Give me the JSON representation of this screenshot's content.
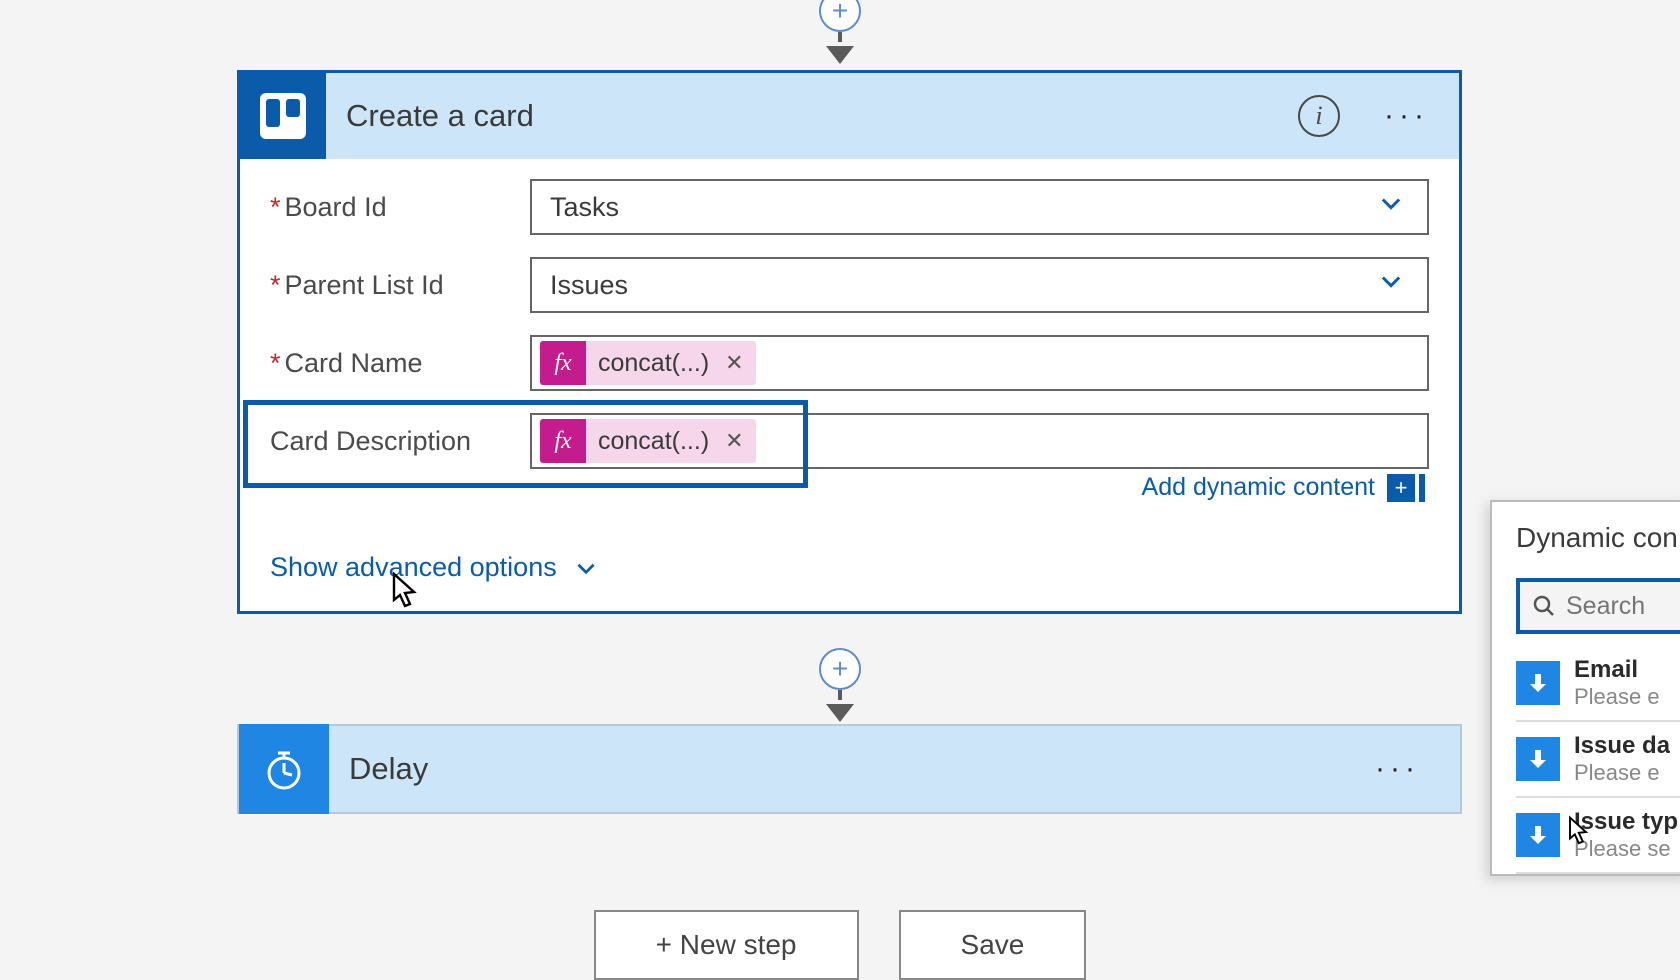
{
  "connector": {
    "plus": "+"
  },
  "action": {
    "title": "Create a card",
    "fields": {
      "boardId": {
        "label": "Board Id",
        "value": "Tasks",
        "required": true
      },
      "parentListId": {
        "label": "Parent List Id",
        "value": "Issues",
        "required": true
      },
      "cardName": {
        "label": "Card Name",
        "token": "concat(...)",
        "required": true
      },
      "cardDescription": {
        "label": "Card Description",
        "token": "concat(...)",
        "required": false
      }
    },
    "fxBadge": "fx",
    "addDynamic": "Add dynamic content",
    "advanced": "Show advanced options"
  },
  "delay": {
    "title": "Delay"
  },
  "buttons": {
    "newStep": "+ New step",
    "save": "Save"
  },
  "dynPanel": {
    "title": "Dynamic con",
    "searchPlaceholder": "Search",
    "items": [
      {
        "title": "Email",
        "sub": "Please e"
      },
      {
        "title": "Issue da",
        "sub": "Please e"
      },
      {
        "title": "Issue typ",
        "sub": "Please se"
      }
    ]
  }
}
